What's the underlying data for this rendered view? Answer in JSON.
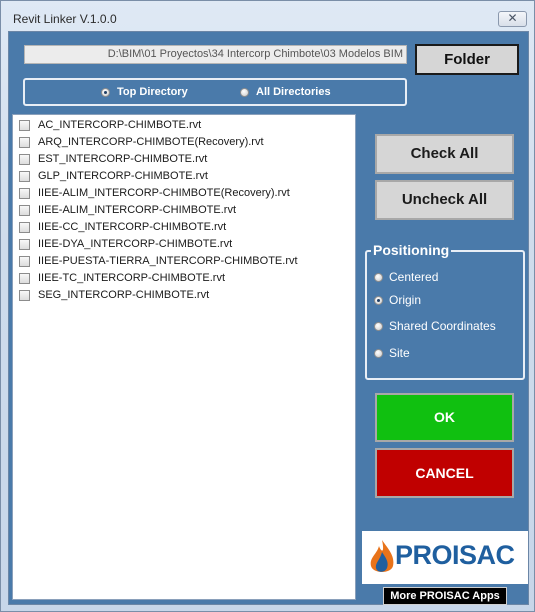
{
  "window": {
    "title": "Revit Linker V.1.0.0",
    "close_glyph": "✕"
  },
  "path": {
    "value": "D:\\BIM\\01 Proyectos\\34 Intercorp Chimbote\\03 Modelos BIM"
  },
  "buttons": {
    "folder": "Folder",
    "check_all": "Check All",
    "uncheck_all": "Uncheck All",
    "ok": "OK",
    "cancel": "CANCEL",
    "more_apps": "More PROISAC Apps"
  },
  "directory_options": [
    {
      "label": "Top Directory",
      "selected": true
    },
    {
      "label": "All Directories",
      "selected": false
    }
  ],
  "files": [
    "AC_INTERCORP-CHIMBOTE.rvt",
    "ARQ_INTERCORP-CHIMBOTE(Recovery).rvt",
    "EST_INTERCORP-CHIMBOTE.rvt",
    "GLP_INTERCORP-CHIMBOTE.rvt",
    "IIEE-ALIM_INTERCORP-CHIMBOTE(Recovery).rvt",
    "IIEE-ALIM_INTERCORP-CHIMBOTE.rvt",
    "IIEE-CC_INTERCORP-CHIMBOTE.rvt",
    "IIEE-DYA_INTERCORP-CHIMBOTE.rvt",
    "IIEE-PUESTA-TIERRA_INTERCORP-CHIMBOTE.rvt",
    "IIEE-TC_INTERCORP-CHIMBOTE.rvt",
    "SEG_INTERCORP-CHIMBOTE.rvt"
  ],
  "positioning": {
    "title": "Positioning",
    "options": [
      {
        "label": "Centered",
        "selected": false
      },
      {
        "label": "Origin",
        "selected": true
      },
      {
        "label": "Shared Coordinates",
        "selected": false
      },
      {
        "label": "Site",
        "selected": false
      }
    ]
  },
  "logo": {
    "text": "PROISAC"
  },
  "colors": {
    "panel_blue": "#4a7aaa",
    "ok_green": "#10c010",
    "cancel_red": "#c00000",
    "brand_blue": "#1f5f9f",
    "flame_orange": "#e8731a"
  }
}
